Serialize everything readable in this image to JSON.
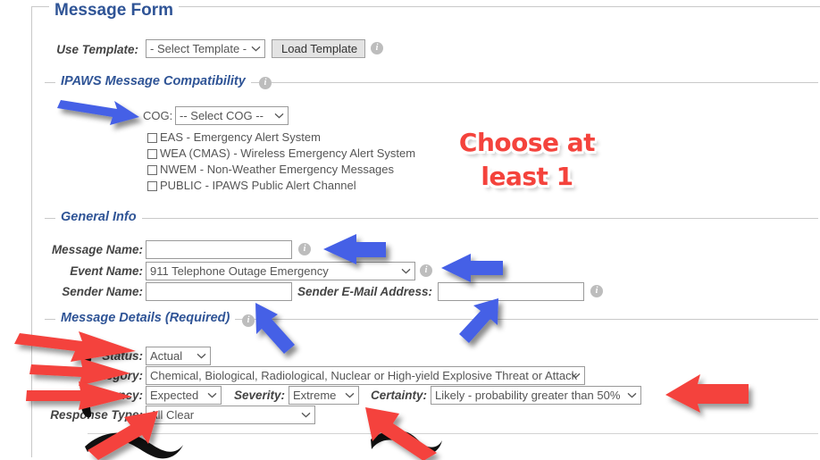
{
  "form": {
    "title": "Message Form",
    "use_template_label": "Use Template:",
    "template_value": "- Select Template -",
    "load_template_button": "Load Template"
  },
  "ipaws": {
    "legend": "IPAWS Message Compatibility",
    "cog_label": "COG:",
    "cog_value": "-- Select COG --",
    "checkboxes": [
      {
        "label": "EAS - Emergency Alert System",
        "checked": false
      },
      {
        "label": "WEA (CMAS) - Wireless Emergency Alert System",
        "checked": false
      },
      {
        "label": "NWEM - Non-Weather Emergency Messages",
        "checked": false
      },
      {
        "label": "PUBLIC - IPAWS Public Alert Channel",
        "checked": false
      }
    ]
  },
  "general_info": {
    "legend": "General Info",
    "message_name_label": "Message Name:",
    "message_name_value": "",
    "event_name_label": "Event Name:",
    "event_name_value": "911 Telephone Outage Emergency",
    "sender_name_label": "Sender Name:",
    "sender_name_value": "",
    "sender_email_label": "Sender E-Mail Address:",
    "sender_email_value": ""
  },
  "message_details": {
    "legend": "Message Details (Required)",
    "status_label": "Status:",
    "status_value": "Actual",
    "category_label": "Category:",
    "category_value": "Chemical, Biological, Radiological, Nuclear or High-yield Explosive Threat or Attack",
    "urgency_label": "Urgency:",
    "urgency_value": "Expected",
    "severity_label": "Severity:",
    "severity_value": "Extreme",
    "certainty_label": "Certainty:",
    "certainty_value": "Likely - probability greater than 50%",
    "response_type_label": "Response Type:",
    "response_type_value": "All Clear"
  },
  "annotations": {
    "choose_at_least_line1": "Choose at",
    "choose_at_least_line2": "least 1",
    "blue_color": "#4560e6",
    "red_color": "#f4433c",
    "shadow_color": "#000000"
  },
  "icons": {
    "info": "i",
    "chevron": "chevron-down-icon"
  }
}
